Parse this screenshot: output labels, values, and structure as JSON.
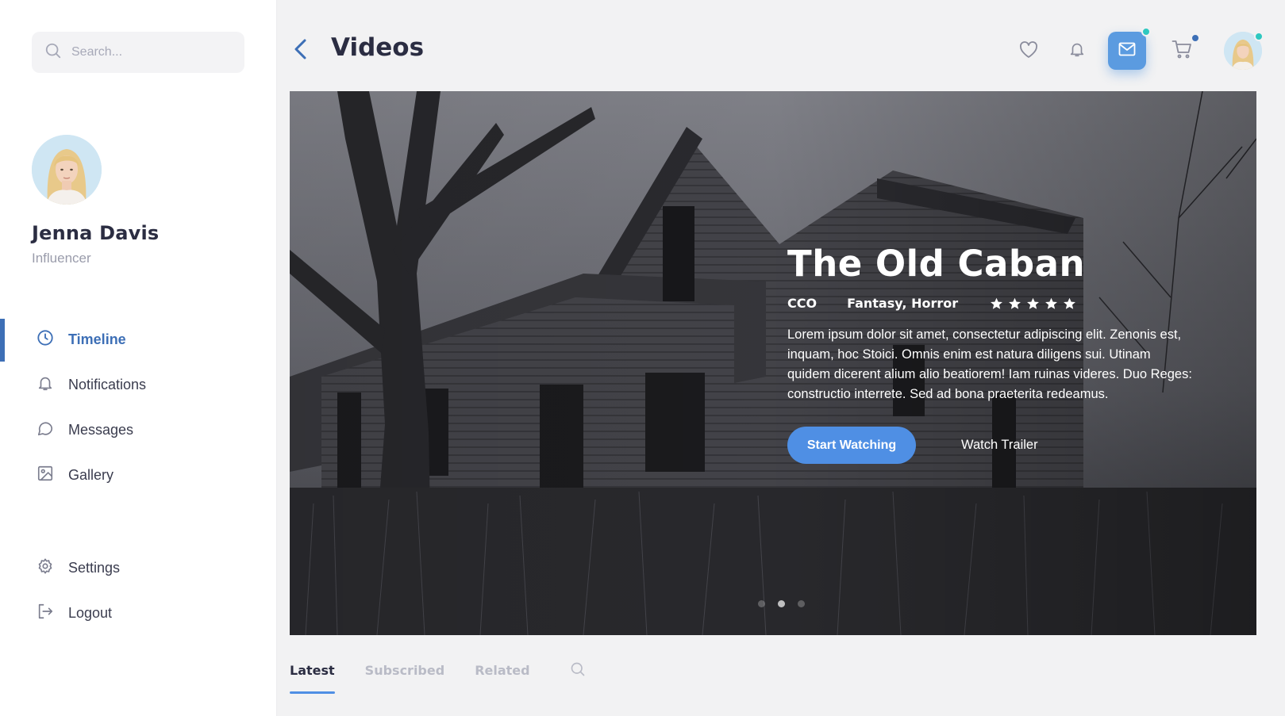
{
  "sidebar": {
    "search": {
      "placeholder": "Search...",
      "icon": "search-icon"
    },
    "profile": {
      "name": "Jenna Davis",
      "role": "Influencer"
    },
    "nav": [
      {
        "label": "Timeline",
        "icon": "clock-icon",
        "active": true
      },
      {
        "label": "Notifications",
        "icon": "bell-icon",
        "active": false
      },
      {
        "label": "Messages",
        "icon": "chat-bubble-icon",
        "active": false
      },
      {
        "label": "Gallery",
        "icon": "image-icon",
        "active": false
      }
    ],
    "nav_bottom": [
      {
        "label": "Settings",
        "icon": "gear-icon"
      },
      {
        "label": "Logout",
        "icon": "logout-icon"
      }
    ]
  },
  "header": {
    "title": "Videos",
    "icons": [
      "heart-icon",
      "bell-icon",
      "mail-icon",
      "cart-icon"
    ]
  },
  "hero": {
    "title": "The Old Caban",
    "rating_label": "CCO",
    "genre": "Fantasy, Horror",
    "stars": 5,
    "description": "Lorem ipsum dolor sit amet, consectetur adipiscing elit. Zenonis est, inquam, hoc Stoici. Omnis enim est natura diligens sui. Utinam quidem dicerent alium alio beatiorem! Iam ruinas videres. Duo Reges: constructio interrete. Sed ad bona praeterita redeamus.",
    "primary_button": "Start Watching",
    "secondary_button": "Watch Trailer",
    "slides": 3,
    "active_slide": 2
  },
  "tabs": [
    {
      "label": "Latest",
      "active": true
    },
    {
      "label": "Subscribed",
      "active": false
    },
    {
      "label": "Related",
      "active": false
    }
  ],
  "colors": {
    "accent": "#3d6fb6",
    "button": "#4f8fe4",
    "mail_button": "#5b9be0",
    "dot_teal": "#2ec8c0",
    "dot_blue": "#3d6fb6"
  }
}
